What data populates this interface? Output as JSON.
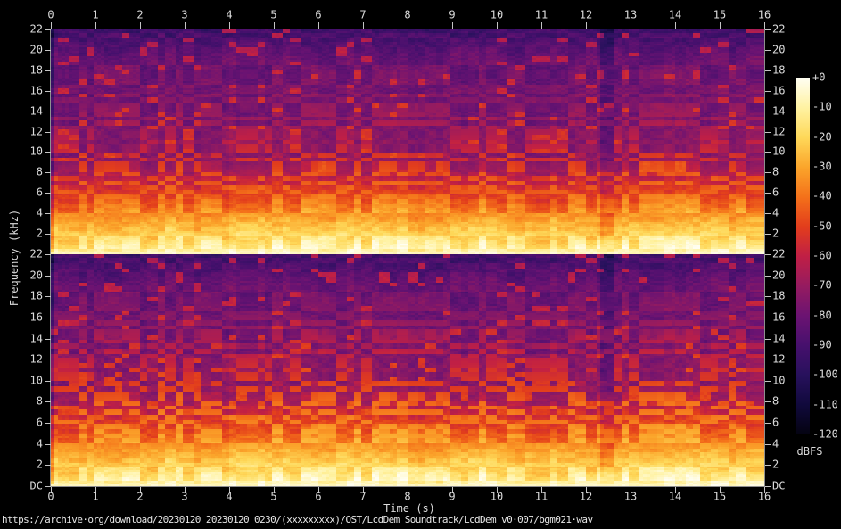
{
  "figure": {
    "xlabel": "Time (s)",
    "ylabel": "Frequency (kHz)",
    "colorbar_label": "dBFS",
    "caption_url": "https://archive·org/download/20230120_20230120_0230/(xxxxxxxxx)/OST/LcdDem Soundtrack/LcdDem v0·007/bgm021·wav",
    "text_color": "#dcdcdc",
    "background_color": "#000000"
  },
  "chart_data": {
    "type": "heatmap",
    "subtype": "audio-spectrogram-stereo",
    "channels": [
      "channel-1 (top)",
      "channel-2 (bottom)"
    ],
    "x_axis": {
      "label": "Time (s)",
      "min": 0,
      "max": 16,
      "unit": "s",
      "tick_labels": [
        "0",
        "1",
        "2",
        "3",
        "4",
        "5",
        "6",
        "7",
        "8",
        "9",
        "10",
        "11",
        "12",
        "13",
        "14",
        "15",
        "16"
      ]
    },
    "y_axis": {
      "label": "Frequency (kHz)",
      "max_khz": 22,
      "min_label": "DC",
      "channel1_tick_labels": [
        "22",
        "20",
        "18",
        "16",
        "14",
        "12",
        "10",
        "8",
        "6",
        "4",
        "2"
      ],
      "channel2_tick_labels": [
        "22",
        "20",
        "18",
        "16",
        "14",
        "12",
        "10",
        "8",
        "6",
        "4",
        "2",
        "DC"
      ]
    },
    "colorbar": {
      "label": "dBFS",
      "max_db": 0,
      "min_db": -120,
      "tick_labels": [
        "+0",
        "-10",
        "-20",
        "-30",
        "-40",
        "-50",
        "-60",
        "-70",
        "-80",
        "-90",
        "-100",
        "-110",
        "-120"
      ],
      "gradient_stops": [
        {
          "db": 0,
          "color": "#fffef2"
        },
        {
          "db": -10,
          "color": "#fff2a2"
        },
        {
          "db": -20,
          "color": "#fed859"
        },
        {
          "db": -30,
          "color": "#fba52b"
        },
        {
          "db": -40,
          "color": "#f4711a"
        },
        {
          "db": -50,
          "color": "#e23d1c"
        },
        {
          "db": -60,
          "color": "#c01f45"
        },
        {
          "db": -70,
          "color": "#951b60"
        },
        {
          "db": -80,
          "color": "#6b1372"
        },
        {
          "db": -90,
          "color": "#46106d"
        },
        {
          "db": -100,
          "color": "#27115c"
        },
        {
          "db": -110,
          "color": "#10093b"
        },
        {
          "db": -120,
          "color": "#040310"
        }
      ]
    },
    "energy_profile": {
      "description": "Music track: bright yellow band below ~2 kHz (-10 to -30 dBFS) with solid DC line, red/orange harmonic note blocks 2-7 kHz (-35 to -55 dBFS), scattered magenta dashes 7-16 kHz (-55 to -70 dBFS), purple noise floor toward 22 kHz (-75 to -95 dBFS), rhythmic vertical striations every ~0.2 s, brief quiet dip near t=12.4 s; both channels nearly identical",
      "render_model": {
        "cols": 200,
        "rows_ch1": 126,
        "rows_ch2": 130,
        "floor_base_db": -70,
        "floor_slope_db_per_khz": 1.0,
        "low_band_db0": -13,
        "low_band_slope": 7.0,
        "dash_db0": -22,
        "dash_slope": 3.6,
        "dash_density": 0.36,
        "streak_db0": -40,
        "streak_slope": 1.2,
        "streak_density": 0.07,
        "block_t_s": 0.2,
        "block_f_khz": 0.45,
        "col_mod_db": 9,
        "quiet_intervals": [
          [
            12.3,
            12.62
          ]
        ],
        "dc_line_db": -9,
        "macro_seed": 7,
        "seed_ch1": 101,
        "seed_ch2": 202
      }
    }
  }
}
